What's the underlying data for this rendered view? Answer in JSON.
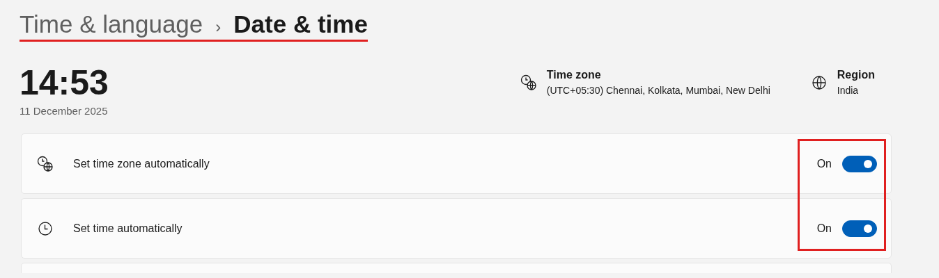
{
  "breadcrumb": {
    "items": [
      {
        "label": "Time & language",
        "current": false
      },
      {
        "label": "Date & time",
        "current": true
      }
    ],
    "separator": "›",
    "underlined": true
  },
  "clock": {
    "time": "14:53",
    "date": "11 December 2025"
  },
  "info": [
    {
      "kind": "timezone",
      "title": "Time zone",
      "value": "(UTC+05:30) Chennai, Kolkata, Mumbai, New Delhi"
    },
    {
      "kind": "region",
      "title": "Region",
      "value": "India"
    }
  ],
  "settings": [
    {
      "kind": "timezone",
      "label": "Set time zone automatically",
      "state_text": "On",
      "on": true
    },
    {
      "kind": "clock",
      "label": "Set time automatically",
      "state_text": "On",
      "on": true
    },
    {
      "kind": "partial"
    }
  ],
  "toggles_highlighted": true
}
